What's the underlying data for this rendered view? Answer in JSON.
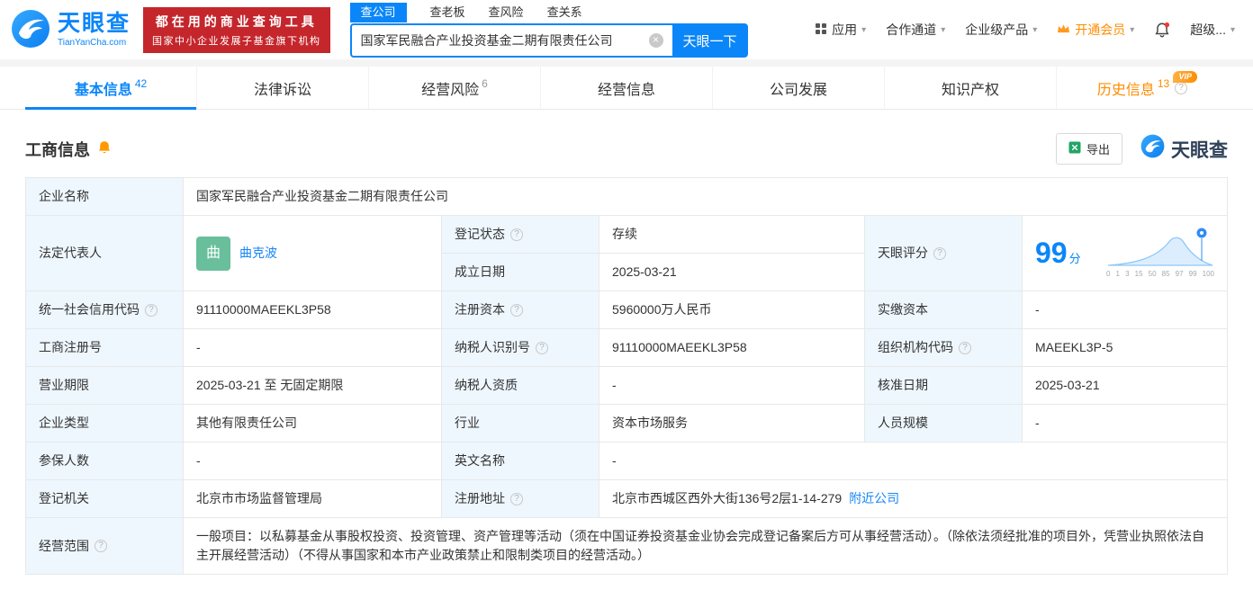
{
  "colors": {
    "primary_blue": "#0b86f8",
    "brand_red": "#c4262c",
    "vip_orange": "#ff8c00",
    "status_green": "#0abf5b",
    "label_cell_bg": "#eef7fe"
  },
  "icons": {
    "clear": "×",
    "chevron_down": "▾",
    "help": "?"
  },
  "header": {
    "logo_title": "天眼查",
    "logo_subtitle": "TianYanCha.com",
    "badge": {
      "line1": "都在用的商业查询工具",
      "line2": "国家中小企业发展子基金旗下机构"
    },
    "search_tabs": [
      "查公司",
      "查老板",
      "查风险",
      "查关系"
    ],
    "search_value": "国家军民融合产业投资基金二期有限责任公司",
    "search_button": "天眼一下",
    "nav": {
      "apps": "应用",
      "partners": "合作通道",
      "enterprise": "企业级产品",
      "vip": "开通会员",
      "user": "超级..."
    }
  },
  "tabbar": {
    "tabs": [
      {
        "label": "基本信息",
        "count": "42"
      },
      {
        "label": "法律诉讼",
        "count": ""
      },
      {
        "label": "经营风险",
        "count": "6"
      },
      {
        "label": "经营信息",
        "count": ""
      },
      {
        "label": "公司发展",
        "count": ""
      },
      {
        "label": "知识产权",
        "count": ""
      },
      {
        "label": "历史信息",
        "count": "13",
        "vip_tag": "VIP"
      }
    ]
  },
  "section": {
    "title": "工商信息",
    "export_label": "导出",
    "brand": "天眼查"
  },
  "table": {
    "company_name": {
      "label": "企业名称",
      "value": "国家军民融合产业投资基金二期有限责任公司"
    },
    "legal_rep": {
      "label": "法定代表人",
      "avatar": "曲",
      "value": "曲克波"
    },
    "reg_status": {
      "label": "登记状态",
      "value": "存续"
    },
    "est_date": {
      "label": "成立日期",
      "value": "2025-03-21"
    },
    "score": {
      "label": "天眼评分",
      "value": "99",
      "unit": "分",
      "ticks": [
        "0",
        "1",
        "3",
        "15",
        "50",
        "85",
        "97",
        "99",
        "100"
      ]
    },
    "credit_code": {
      "label": "统一社会信用代码",
      "value": "91110000MAEEKL3P58"
    },
    "reg_capital": {
      "label": "注册资本",
      "value": "5960000万人民币"
    },
    "paid_capital": {
      "label": "实缴资本",
      "value": "-"
    },
    "reg_number": {
      "label": "工商注册号",
      "value": "-"
    },
    "taxpayer_id": {
      "label": "纳税人识别号",
      "value": "91110000MAEEKL3P58"
    },
    "org_code": {
      "label": "组织机构代码",
      "value": "MAEEKL3P-5"
    },
    "business_term": {
      "label": "营业期限",
      "value": "2025-03-21 至 无固定期限"
    },
    "taxpayer_quality": {
      "label": "纳税人资质",
      "value": "-"
    },
    "approval_date": {
      "label": "核准日期",
      "value": "2025-03-21"
    },
    "company_type": {
      "label": "企业类型",
      "value": "其他有限责任公司"
    },
    "industry": {
      "label": "行业",
      "value": "资本市场服务"
    },
    "staff_size": {
      "label": "人员规模",
      "value": "-"
    },
    "insured_count": {
      "label": "参保人数",
      "value": "-"
    },
    "english_name": {
      "label": "英文名称",
      "value": "-"
    },
    "reg_authority": {
      "label": "登记机关",
      "value": "北京市市场监督管理局"
    },
    "reg_address": {
      "label": "注册地址",
      "value": "北京市西城区西外大街136号2层1-14-279",
      "link": "附近公司"
    },
    "business_scope": {
      "label": "经营范围",
      "value": "一般项目：以私募基金从事股权投资、投资管理、资产管理等活动（须在中国证券投资基金业协会完成登记备案后方可从事经营活动）。（除依法须经批准的项目外，凭营业执照依法自主开展经营活动）（不得从事国家和本市产业政策禁止和限制类项目的经营活动。）"
    }
  }
}
